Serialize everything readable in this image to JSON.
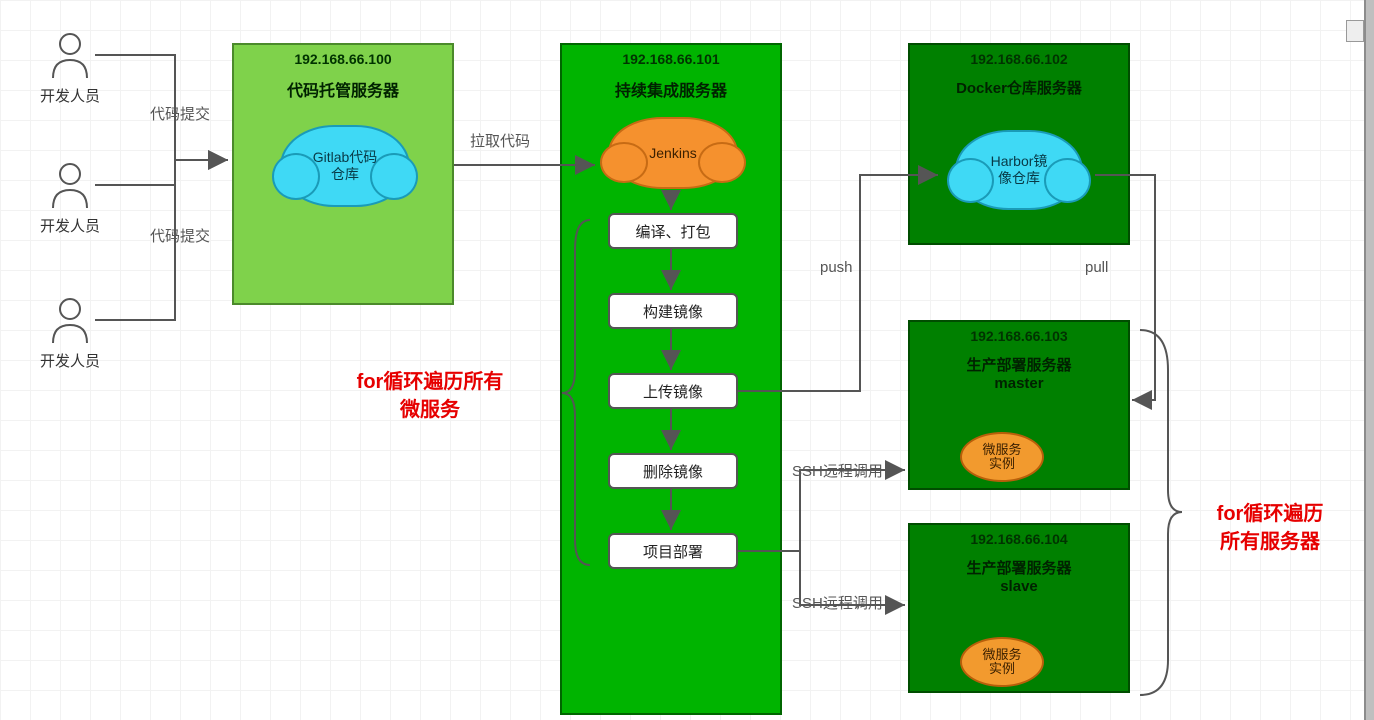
{
  "developers": [
    {
      "label": "开发人员"
    },
    {
      "label": "开发人员"
    },
    {
      "label": "开发人员"
    }
  ],
  "servers": {
    "code": {
      "ip": "192.168.66.100",
      "title": "代码托管服务器",
      "cloud": "Gitlab代码\n仓库"
    },
    "ci": {
      "ip": "192.168.66.101",
      "title": "持续集成服务器",
      "cloud": "Jenkins"
    },
    "registry": {
      "ip": "192.168.66.102",
      "title": "Docker仓库服务器",
      "cloud": "Harbor镜\n像仓库"
    },
    "prod_master": {
      "ip": "192.168.66.103",
      "title": "生产部署服务器\nmaster",
      "ellipse": "微服务\n实例"
    },
    "prod_slave": {
      "ip": "192.168.66.104",
      "title": "生产部署服务器\nslave",
      "ellipse": "微服务\n实例"
    }
  },
  "steps": [
    "编译、打包",
    "构建镜像",
    "上传镜像",
    "删除镜像",
    "项目部署"
  ],
  "edges": {
    "commit": "代码提交",
    "pull_code": "拉取代码",
    "push": "push",
    "pull": "pull",
    "ssh": "SSH远程调用"
  },
  "notes": {
    "left": "for循环遍历所有\n微服务",
    "right": "for循环遍历\n所有服务器"
  }
}
